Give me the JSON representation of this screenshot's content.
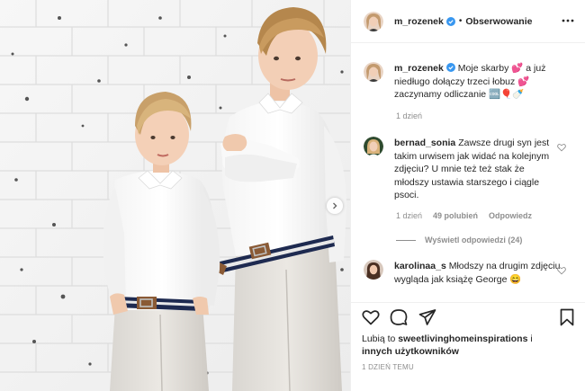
{
  "post": {
    "author": "m_rozenek",
    "follow_label": "Obserwowanie",
    "separator": "•",
    "caption_text": "Moje skarby 💕 a już niedługo dołączy trzeci łobuz 💕 zaczynamy odliczanie 🆒🎈🍼",
    "caption_time": "1 dzień"
  },
  "comments": [
    {
      "user": "bernad_sonia",
      "text": "Zawsze drugi syn jest takim urwisem jak widać na kolejnym zdjęciu? U mnie też też stak że młodszy ustawia starszego i ciągle psoci.",
      "time": "1 dzień",
      "likes": "49 polubień",
      "reply_label": "Odpowiedz",
      "view_replies": "Wyświetl odpowiedzi (24)"
    },
    {
      "user": "karolinaa_s",
      "text": "Młodszy na drugim zdjęciu wygląda jak książę George 😄"
    }
  ],
  "likes": {
    "prefix": "Lubią to",
    "user": "sweetlivinghomeinspirations",
    "connector": "i",
    "others": "innych użytkowników"
  },
  "posted_ago": "1 DZIEŃ TEMU",
  "icons": [
    "verified-badge-icon",
    "more-options-icon",
    "heart-icon",
    "comment-icon",
    "share-icon",
    "bookmark-icon",
    "chevron-right-icon"
  ],
  "colors": {
    "verified": "#3897f0",
    "text": "#262626",
    "muted": "#8e8e8e",
    "border": "#efefef"
  }
}
